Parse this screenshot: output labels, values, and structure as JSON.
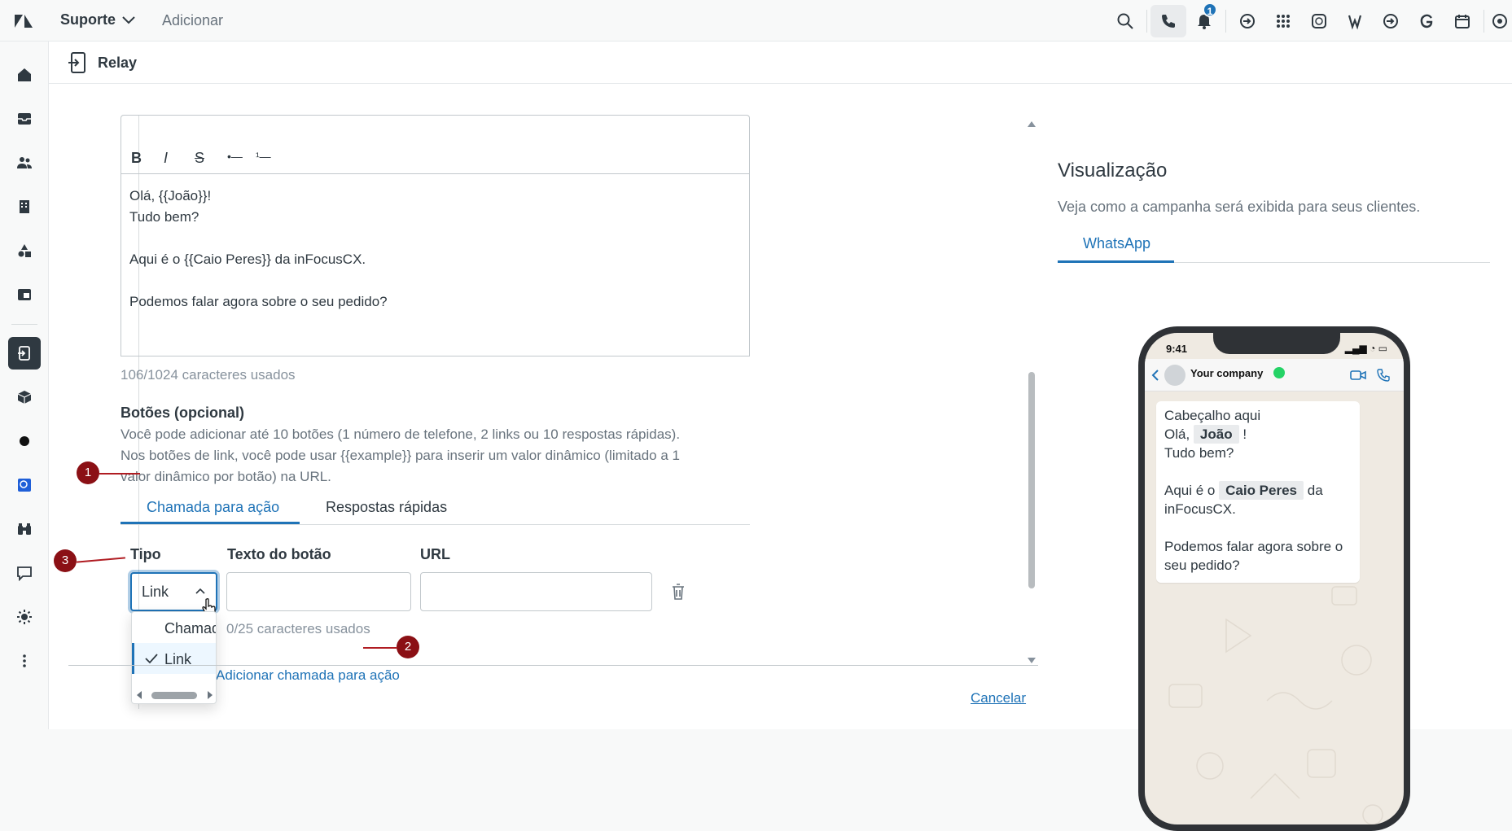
{
  "topbar": {
    "product": "Suporte",
    "add": "Adicionar",
    "notification_count": "1",
    "icons": [
      "search-icon",
      "phone-icon",
      "bell-icon",
      "app-icon",
      "grid-icon",
      "whatsapp-icon",
      "w-icon",
      "app-icon",
      "g-icon",
      "calendar-icon",
      "apps-icon"
    ]
  },
  "sidebar": {
    "items": [
      "home-icon",
      "inbox-icon",
      "users-icon",
      "building-icon",
      "shapes-icon",
      "reports-icon",
      "relay-icon",
      "cube-icon",
      "dot-icon",
      "app-icon",
      "binoculars-icon",
      "chat-icon",
      "sun-icon",
      "more-icon"
    ]
  },
  "subheader": {
    "title": "Relay"
  },
  "editor": {
    "toolbar": [
      "B",
      "I",
      "S",
      "•—",
      "¹—"
    ],
    "message": "Olá, {{João}}!\nTudo bem?\n\nAqui é o {{Caio Peres}} da inFocusCX.\n\nPodemos falar agora sobre o seu pedido?",
    "counter": "106/1024 caracteres usados"
  },
  "buttons": {
    "title": "Botões (opcional)",
    "description": "Você pode adicionar até 10 botões (1 número de telefone, 2 links ou 10 respostas rápidas). Nos botões de link, você pode usar {{example}} para inserir um valor dinâmico (limitado a 1 valor dinâmico por botão) na URL.",
    "tabs": [
      "Chamada para ação",
      "Respostas rápidas"
    ],
    "columns": {
      "type": "Tipo",
      "text": "Texto do botão",
      "url": "URL"
    },
    "select_value": "Link",
    "text_counter": "0/25 caracteres usados",
    "dropdown_options": [
      "Chamada",
      "Link"
    ],
    "add_cta": "Adicionar chamada para ação"
  },
  "footer": {
    "cancel": "Cancelar"
  },
  "preview": {
    "title": "Visualização",
    "description": "Veja como a campanha será exibida para seus clientes.",
    "tab": "WhatsApp",
    "phone": {
      "time": "9:41",
      "company": "Your company",
      "header_line": "Cabeçalho aqui",
      "greeting_prefix": "Olá,",
      "name_chip": "João",
      "greeting_suffix": "!",
      "line2": "Tudo bem?",
      "line3_prefix": "Aqui é o",
      "agent_chip": "Caio Peres",
      "line3_suffix": "da inFocusCX.",
      "line4": "Podemos falar agora sobre o seu pedido?"
    }
  },
  "annotations": [
    "1",
    "2",
    "3"
  ],
  "colors": {
    "accent": "#1f73b7",
    "annotation": "#8b1015",
    "dark": "#2f3941"
  }
}
